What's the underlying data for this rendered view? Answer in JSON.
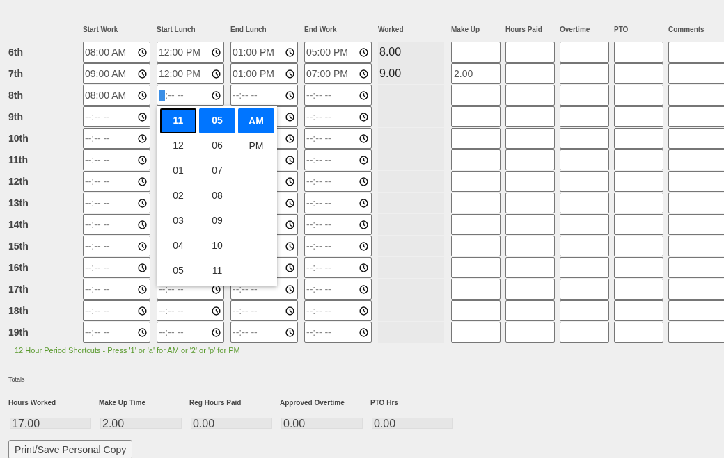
{
  "columns": [
    "Start Work",
    "Start Lunch",
    "End Lunch",
    "End Work",
    "Worked",
    "Make Up",
    "Hours Paid",
    "Overtime",
    "PTO",
    "Comments"
  ],
  "rows": [
    {
      "day": "6th",
      "start_work": {
        "value": "08:00 AM"
      },
      "start_lunch": {
        "value": "12:00 PM"
      },
      "end_lunch": {
        "value": "01:00 PM"
      },
      "end_work": {
        "value": "05:00 PM"
      },
      "worked": "8.00"
    },
    {
      "day": "7th",
      "start_work": {
        "value": "09:00 AM"
      },
      "start_lunch": {
        "value": "12:00 PM"
      },
      "end_lunch": {
        "value": "01:00 PM"
      },
      "end_work": {
        "value": "07:00 PM"
      },
      "worked": "9.00",
      "make_up": "2.00"
    },
    {
      "day": "8th",
      "start_work": {
        "value": "08:00 AM"
      },
      "start_lunch": {
        "placeholder": "--:-- --",
        "picker": [
          {
            "focused": true,
            "options": [
              {
                "label": "11",
                "selected": true
              },
              {
                "label": "12",
                "selected": false
              },
              {
                "label": "01",
                "selected": false
              },
              {
                "label": "02",
                "selected": false
              },
              {
                "label": "03",
                "selected": false
              },
              {
                "label": "04",
                "selected": false
              },
              {
                "label": "05",
                "selected": false
              }
            ]
          },
          {
            "focused": false,
            "options": [
              {
                "label": "05",
                "selected": true
              },
              {
                "label": "06",
                "selected": false
              },
              {
                "label": "07",
                "selected": false
              },
              {
                "label": "08",
                "selected": false
              },
              {
                "label": "09",
                "selected": false
              },
              {
                "label": "10",
                "selected": false
              },
              {
                "label": "11",
                "selected": false
              }
            ]
          },
          {
            "focused": false,
            "options": [
              {
                "label": "AM",
                "selected": true
              },
              {
                "label": "PM",
                "selected": false
              }
            ]
          }
        ]
      },
      "end_lunch": {
        "placeholder": "--:-- --"
      },
      "end_work": {
        "placeholder": "--:-- --"
      }
    },
    {
      "day": "9th",
      "start_work": {
        "placeholder": "--:-- --"
      },
      "end_work": {
        "placeholder": "--:-- --"
      }
    },
    {
      "day": "10th",
      "start_work": {
        "placeholder": "--:-- --"
      },
      "end_work": {
        "placeholder": "--:-- --"
      }
    },
    {
      "day": "11th",
      "start_work": {
        "placeholder": "--:-- --"
      },
      "end_work": {
        "placeholder": "--:-- --"
      }
    },
    {
      "day": "12th",
      "start_work": {
        "placeholder": "--:-- --"
      },
      "end_work": {
        "placeholder": "--:-- --"
      }
    },
    {
      "day": "13th",
      "start_work": {
        "placeholder": "--:-- --"
      },
      "end_work": {
        "placeholder": "--:-- --"
      }
    },
    {
      "day": "14th",
      "start_work": {
        "placeholder": "--:-- --"
      },
      "end_work": {
        "placeholder": "--:-- --"
      }
    },
    {
      "day": "15th",
      "start_work": {
        "placeholder": "--:-- --"
      },
      "end_work": {
        "placeholder": "--:-- --"
      }
    },
    {
      "day": "16th",
      "start_work": {
        "placeholder": "--:-- --"
      },
      "end_work": {
        "placeholder": "--:-- --"
      }
    },
    {
      "day": "17th",
      "start_work": {
        "placeholder": "--:-- --"
      },
      "start_lunch": {
        "placeholder": "--:-- --"
      },
      "end_lunch": {
        "placeholder": "--:-- --"
      },
      "end_work": {
        "placeholder": "--:-- --"
      }
    },
    {
      "day": "18th",
      "start_work": {
        "placeholder": "--:-- --"
      },
      "start_lunch": {
        "placeholder": "--:-- --"
      },
      "end_lunch": {
        "placeholder": "--:-- --"
      },
      "end_work": {
        "placeholder": "--:-- --"
      }
    },
    {
      "day": "19th",
      "start_work": {
        "placeholder": "--:-- --"
      },
      "start_lunch": {
        "placeholder": "--:-- --"
      },
      "end_lunch": {
        "placeholder": "--:-- --"
      },
      "end_work": {
        "placeholder": "--:-- --"
      }
    }
  ],
  "shortcut_hint": "12 Hour Period Shortcuts - Press '1' or 'a' for AM or '2' or 'p' for PM",
  "totals": {
    "title": "Totals",
    "items": [
      {
        "label": "Hours Worked",
        "value": "17.00"
      },
      {
        "label": "Make Up Time",
        "value": "2.00"
      },
      {
        "label": "Reg Hours Paid",
        "value": "0.00"
      },
      {
        "label": "Approved Overtime",
        "value": "0.00"
      },
      {
        "label": "PTO Hrs",
        "value": "0.00"
      }
    ]
  },
  "print_button": "Print/Save Personal Copy"
}
